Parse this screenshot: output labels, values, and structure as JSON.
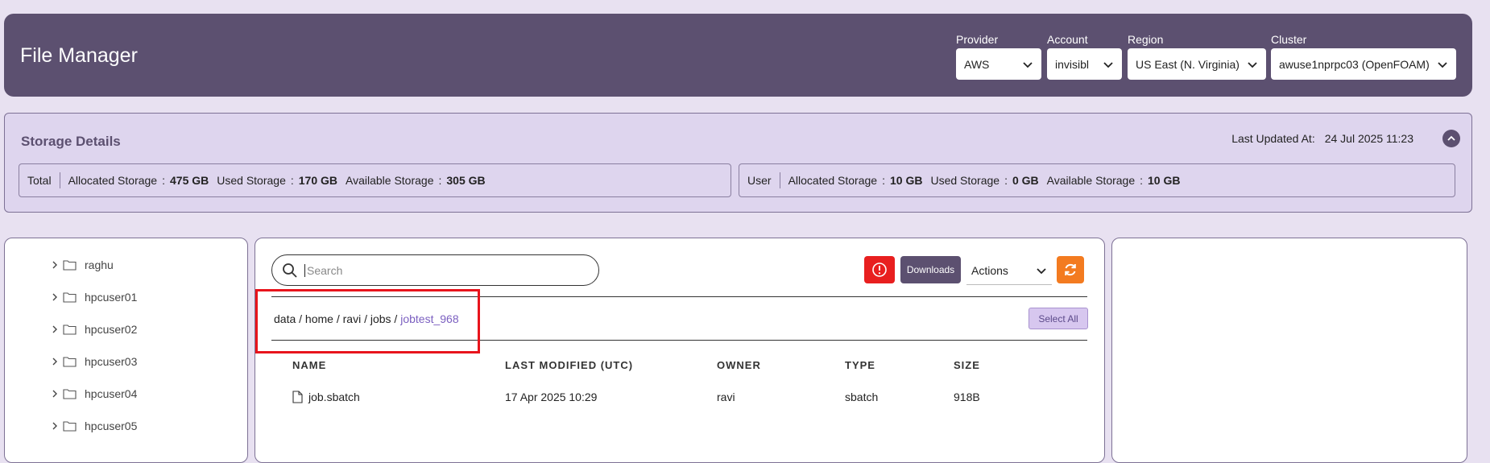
{
  "header": {
    "title": "File Manager",
    "provider": {
      "label": "Provider",
      "value": "AWS"
    },
    "account": {
      "label": "Account",
      "value": "invisibl"
    },
    "region": {
      "label": "Region",
      "value": "US East (N. Virginia)"
    },
    "cluster": {
      "label": "Cluster",
      "value": "awuse1nprpc03 (OpenFOAM)"
    }
  },
  "storage": {
    "title": "Storage Details",
    "last_updated_label": "Last Updated At:",
    "last_updated_value": "24 Jul 2025 11:23",
    "separator": ":",
    "total": {
      "tag": "Total",
      "allocated_label": "Allocated Storage",
      "allocated_value": "475 GB",
      "used_label": "Used Storage",
      "used_value": "170 GB",
      "available_label": "Available Storage",
      "available_value": "305 GB"
    },
    "user": {
      "tag": "User",
      "allocated_label": "Allocated Storage",
      "allocated_value": "10 GB",
      "used_label": "Used Storage",
      "used_value": "0 GB",
      "available_label": "Available Storage",
      "available_value": "10 GB"
    }
  },
  "tree": {
    "items": [
      {
        "label": "raghu"
      },
      {
        "label": "hpcuser01"
      },
      {
        "label": "hpcuser02"
      },
      {
        "label": "hpcuser03"
      },
      {
        "label": "hpcuser04"
      },
      {
        "label": "hpcuser05"
      }
    ]
  },
  "toolbar": {
    "search_placeholder": "Search",
    "downloads_label": "Downloads",
    "actions_label": "Actions",
    "select_all_label": "Select All"
  },
  "breadcrumb": {
    "parts": [
      "data",
      "home",
      "ravi",
      "jobs"
    ],
    "separator": " / ",
    "current": "jobtest_968"
  },
  "table": {
    "headers": {
      "name": "NAME",
      "modified": "LAST MODIFIED (UTC)",
      "owner": "OWNER",
      "type": "TYPE",
      "size": "SIZE"
    },
    "rows": [
      {
        "name": "job.sbatch",
        "modified": "17 Apr 2025 10:29",
        "owner": "ravi",
        "type": "sbatch",
        "size": "918B"
      }
    ]
  },
  "colors": {
    "header_bg": "#5c5070",
    "page_bg": "#e8e1f1",
    "alert": "#e81f1f",
    "refresh": "#f37b20",
    "highlight": "#e8141c",
    "breadcrumb_current": "#7b5fc0"
  }
}
